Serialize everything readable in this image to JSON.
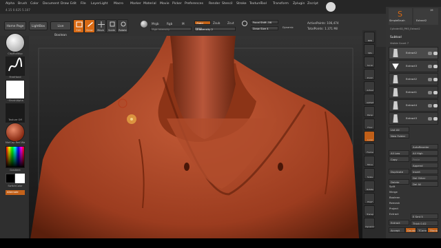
{
  "menu": [
    "Alpha",
    "Brush",
    "Color",
    "Document",
    "Draw",
    "Edit",
    "File",
    "Layer",
    "Light",
    "Macro",
    "Marker",
    "Material",
    "Movie",
    "Picker",
    "Preferences",
    "Render",
    "Stencil",
    "Stroke",
    "Texture",
    "Tool",
    "Transform",
    "Zplugin",
    "Zscript"
  ],
  "version": "4.15 0.025 5.107",
  "toolbar": {
    "home_page": "Home Page",
    "lightbox": "LightBox",
    "live_boolean": "Live Boolean",
    "edit": "Edit",
    "draw": "Draw",
    "move": "Move",
    "scale": "Scale",
    "rotate": "Rotate",
    "mrgb": "Mrgb",
    "rgb": "Rgb",
    "m": "M",
    "zadd": "Zadd",
    "zsub": "Zsub",
    "zcut": "Zcut",
    "rgb_intensity": "Rgb Intensity",
    "z_intensity": "Z Intensity 2",
    "focal_shift": "Focal Shift -56",
    "draw_size": "Draw Size 4",
    "dynamic": "Dynamic",
    "active_points": "ActivePoints: 106,474",
    "total_points": "TotalPoints: 1.371 Mil"
  },
  "left_shelf": {
    "brush": "ClayBuildup",
    "stroke": "FreeHand",
    "alpha": "~BrushAlpha",
    "texture": "Texture Off",
    "material": "MatCap Red Wa",
    "gradient": "Gradient",
    "switch_color": "SwitchColor",
    "alternate": "Alternate"
  },
  "right_shelf": [
    "BPR",
    "SPix",
    "Scroll",
    "Zoom",
    "Actual",
    "AAHalf",
    "Persp",
    "Floor",
    "Local",
    "Frame",
    "Move",
    "Scale",
    "Rotate",
    "PolyF",
    "Transp",
    "Dynamic"
  ],
  "tray": {
    "tool_name": "SimpleBrush",
    "tool_count": "19",
    "extract_tool": "Extract2",
    "cylinder_label": "Cylinder3D_PM3_Extract2",
    "subtool_title": "Subtool",
    "visible_count": "Visible Count 7",
    "subtools": [
      "Extract2",
      "Extract3",
      "Extract2",
      "Extract1",
      "Extract4",
      "Extract3"
    ],
    "list_all": "List All",
    "new_folder": "New Folder",
    "auto_reorder": "AutoReorder",
    "all_low": "All Low",
    "all_high": "All High",
    "copy": "Copy",
    "paste": "Paste",
    "append": "Append",
    "duplicate": "Duplicate",
    "insert": "Insert",
    "del_other": "Del Other",
    "delete": "Delete",
    "del_all": "Del All",
    "split": "Split",
    "merge": "Merge",
    "boolean": "Boolean",
    "remesh": "Remesh",
    "project": "Project",
    "extract": "Extract",
    "extract_btn": "Extract",
    "e_smt": "E Smt 5",
    "thick": "Thick 0.02",
    "accept": "Accept",
    "double": "Double",
    "tcorne": "TCorne",
    "tborder": "TBorde"
  },
  "colors": {
    "accent": "#d96a14",
    "skin": "#b5492a"
  }
}
